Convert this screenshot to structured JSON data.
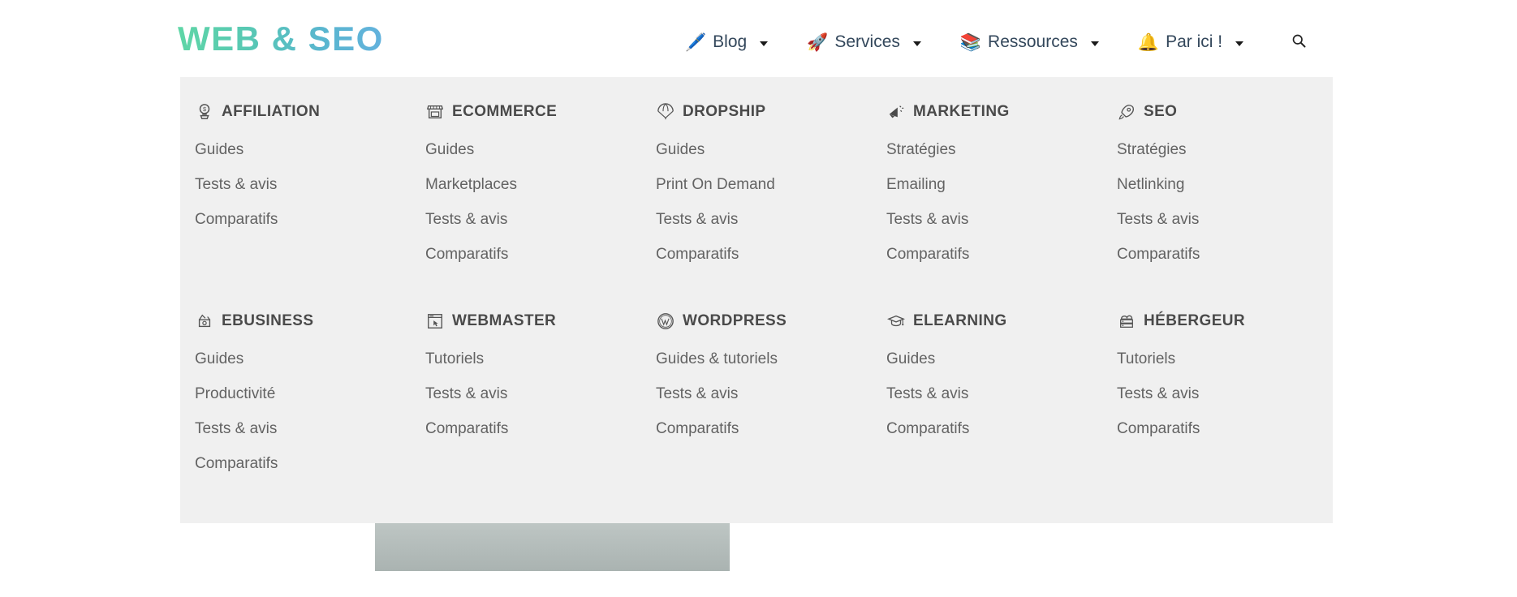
{
  "header": {
    "logo": "WEB & SEO",
    "nav": [
      {
        "icon": "pen-icon",
        "emoji": "🖊️",
        "label": "Blog",
        "has_dropdown": true
      },
      {
        "icon": "rocket-icon",
        "emoji": "🚀",
        "label": "Services",
        "has_dropdown": true
      },
      {
        "icon": "books-icon",
        "emoji": "📚",
        "label": "Ressources",
        "has_dropdown": true
      },
      {
        "icon": "bell-icon",
        "emoji": "🔔",
        "label": "Par ici !",
        "has_dropdown": true
      }
    ],
    "search": {
      "icon": "search-icon",
      "label": "Rechercher"
    }
  },
  "megamenu": {
    "background_color": "#f0f0f0",
    "rows": [
      {
        "columns": [
          {
            "icon": "money-bulb-icon",
            "title": "AFFILIATION",
            "links": [
              "Guides",
              "Tests & avis",
              "Comparatifs"
            ]
          },
          {
            "icon": "storefront-icon",
            "title": "ECOMMERCE",
            "links": [
              "Guides",
              "Marketplaces",
              "Tests & avis",
              "Comparatifs"
            ]
          },
          {
            "icon": "parachute-icon",
            "title": "DROPSHIP",
            "links": [
              "Guides",
              "Print On Demand",
              "Tests & avis",
              "Comparatifs"
            ]
          },
          {
            "icon": "megaphone-icon",
            "title": "MARKETING",
            "links": [
              "Stratégies",
              "Emailing",
              "Tests & avis",
              "Comparatifs"
            ]
          },
          {
            "icon": "rocket-icon",
            "title": "SEO",
            "links": [
              "Stratégies",
              "Netlinking",
              "Tests & avis",
              "Comparatifs"
            ]
          }
        ]
      },
      {
        "columns": [
          {
            "icon": "money-wings-icon",
            "title": "EBUSINESS",
            "links": [
              "Guides",
              "Productivité",
              "Tests & avis",
              "Comparatifs"
            ]
          },
          {
            "icon": "browser-pointer-icon",
            "title": "WEBMASTER",
            "links": [
              "Tutoriels",
              "Tests & avis",
              "Comparatifs"
            ]
          },
          {
            "icon": "wordpress-icon",
            "title": "WORDPRESS",
            "links": [
              "Guides & tutoriels",
              "Tests & avis",
              "Comparatifs"
            ]
          },
          {
            "icon": "graduation-cap-icon",
            "title": "ELEARNING",
            "links": [
              "Guides",
              "Tests & avis",
              "Comparatifs"
            ]
          },
          {
            "icon": "server-cloud-icon",
            "title": "HÉBERGEUR",
            "links": [
              "Tutoriels",
              "Tests & avis",
              "Comparatifs"
            ]
          }
        ]
      }
    ]
  },
  "background_content": {
    "hero_image": "desk-with-imac-photo"
  },
  "colors": {
    "logo_gradient_start": "#5fd6a6",
    "logo_gradient_end": "#63b2dd",
    "menu_background": "#f0f0f0",
    "heading_text": "#4a4a4a",
    "link_text": "#636363",
    "nav_text": "#33475b"
  }
}
